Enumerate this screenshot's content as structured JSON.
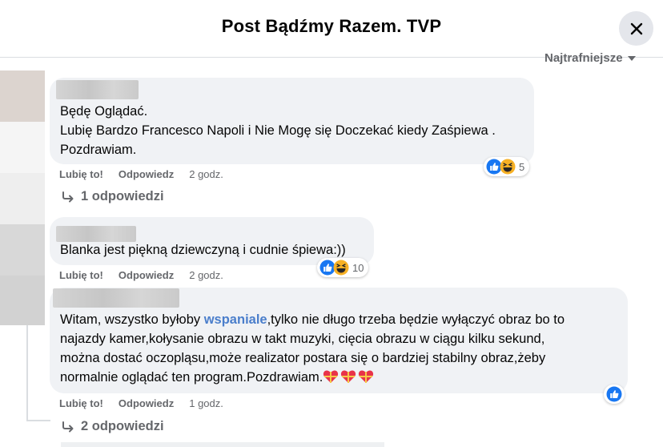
{
  "header": {
    "title": "Post Bądźmy Razem. TVP"
  },
  "sort": {
    "label": "Najtrafniejsze"
  },
  "comments": [
    {
      "lines": [
        "Będę Oglądać.",
        "Lubię Bardzo Francesco Napoli i Nie Mogę się Doczekać kiedy Zaśpiewa .",
        "Pozdrawiam."
      ],
      "like_label": "Lubię to!",
      "reply_label": "Odpowiedz",
      "time": "2 godz.",
      "reaction_count": "5",
      "replies_label": "1 odpowiedzi"
    },
    {
      "lines": [
        "Blanka jest piękną dziewczyną i cudnie śpiewa:))"
      ],
      "like_label": "Lubię to!",
      "reply_label": "Odpowiedz",
      "time": "2 godz.",
      "reaction_count": "10"
    },
    {
      "line1_pre": "Witam, wszystko byłoby ",
      "line1_hl": "wspaniale",
      "line1_post": ",tylko nie długo trzeba będzie wyłączyć obraz bo to",
      "line2": "najazdy kamer,kołysanie obrazu w takt muzyki, cięcia obrazu w ciągu kilku sekund,",
      "line3": "można dostać oczopląsu,może realizator postara się o bardziej stabilny obraz,żeby",
      "line4": "normalnie oglądać ten program.Pozdrawiam.",
      "like_label": "Lubię to!",
      "reply_label": "Odpowiedz",
      "time": "1 godz.",
      "replies_label": "2 odpowiedzi"
    }
  ],
  "colors": {
    "like_blue": "#1877f2",
    "haha_yellow": "#f7b125",
    "link": "#4a7ecb",
    "muted": "#65676b"
  }
}
